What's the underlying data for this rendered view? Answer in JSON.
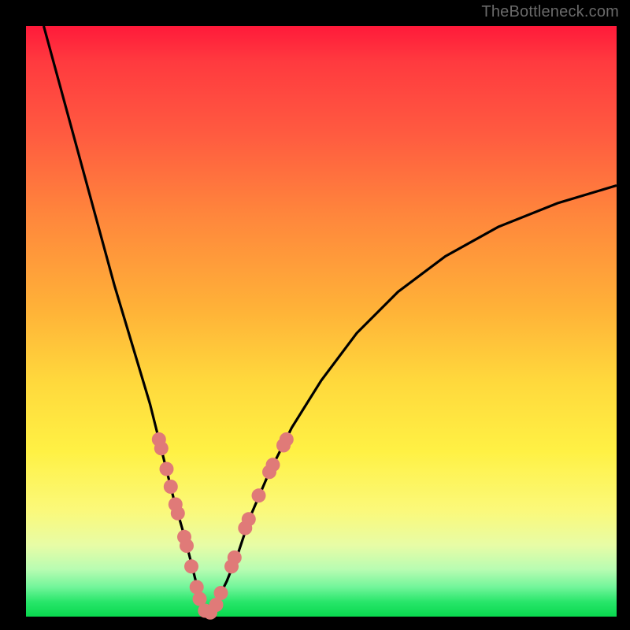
{
  "watermark": "TheBottleneck.com",
  "colors": {
    "frame": "#000000",
    "curve": "#000000",
    "marker_fill": "#e07a78",
    "marker_stroke": "#cf6a68"
  },
  "chart_data": {
    "type": "line",
    "title": "",
    "xlabel": "",
    "ylabel": "",
    "xlim": [
      0,
      100
    ],
    "ylim": [
      0,
      100
    ],
    "grid": false,
    "legend": false,
    "series": [
      {
        "name": "bottleneck-curve",
        "x": [
          3,
          6,
          9,
          12,
          15,
          18,
          21,
          23,
          25,
          27,
          28,
          29,
          30,
          31,
          32,
          34,
          36,
          38,
          41,
          45,
          50,
          56,
          63,
          71,
          80,
          90,
          100
        ],
        "y": [
          100,
          89,
          78,
          67,
          56,
          46,
          36,
          28,
          20,
          13,
          9,
          5,
          2,
          0.5,
          2,
          6,
          11,
          17,
          24,
          32,
          40,
          48,
          55,
          61,
          66,
          70,
          73
        ]
      }
    ],
    "markers": [
      {
        "x": 22.5,
        "y": 30
      },
      {
        "x": 22.9,
        "y": 28.5
      },
      {
        "x": 23.8,
        "y": 25
      },
      {
        "x": 24.5,
        "y": 22
      },
      {
        "x": 25.3,
        "y": 19
      },
      {
        "x": 25.7,
        "y": 17.5
      },
      {
        "x": 26.8,
        "y": 13.5
      },
      {
        "x": 27.2,
        "y": 12
      },
      {
        "x": 28.0,
        "y": 8.5
      },
      {
        "x": 28.9,
        "y": 5
      },
      {
        "x": 29.4,
        "y": 3
      },
      {
        "x": 30.3,
        "y": 1
      },
      {
        "x": 31.2,
        "y": 0.7
      },
      {
        "x": 32.2,
        "y": 2
      },
      {
        "x": 33.0,
        "y": 4
      },
      {
        "x": 34.8,
        "y": 8.5
      },
      {
        "x": 35.3,
        "y": 10
      },
      {
        "x": 37.1,
        "y": 15
      },
      {
        "x": 37.7,
        "y": 16.5
      },
      {
        "x": 39.4,
        "y": 20.5
      },
      {
        "x": 41.2,
        "y": 24.5
      },
      {
        "x": 41.8,
        "y": 25.7
      },
      {
        "x": 43.6,
        "y": 29
      },
      {
        "x": 44.1,
        "y": 30
      }
    ],
    "marker_radius": 9
  }
}
